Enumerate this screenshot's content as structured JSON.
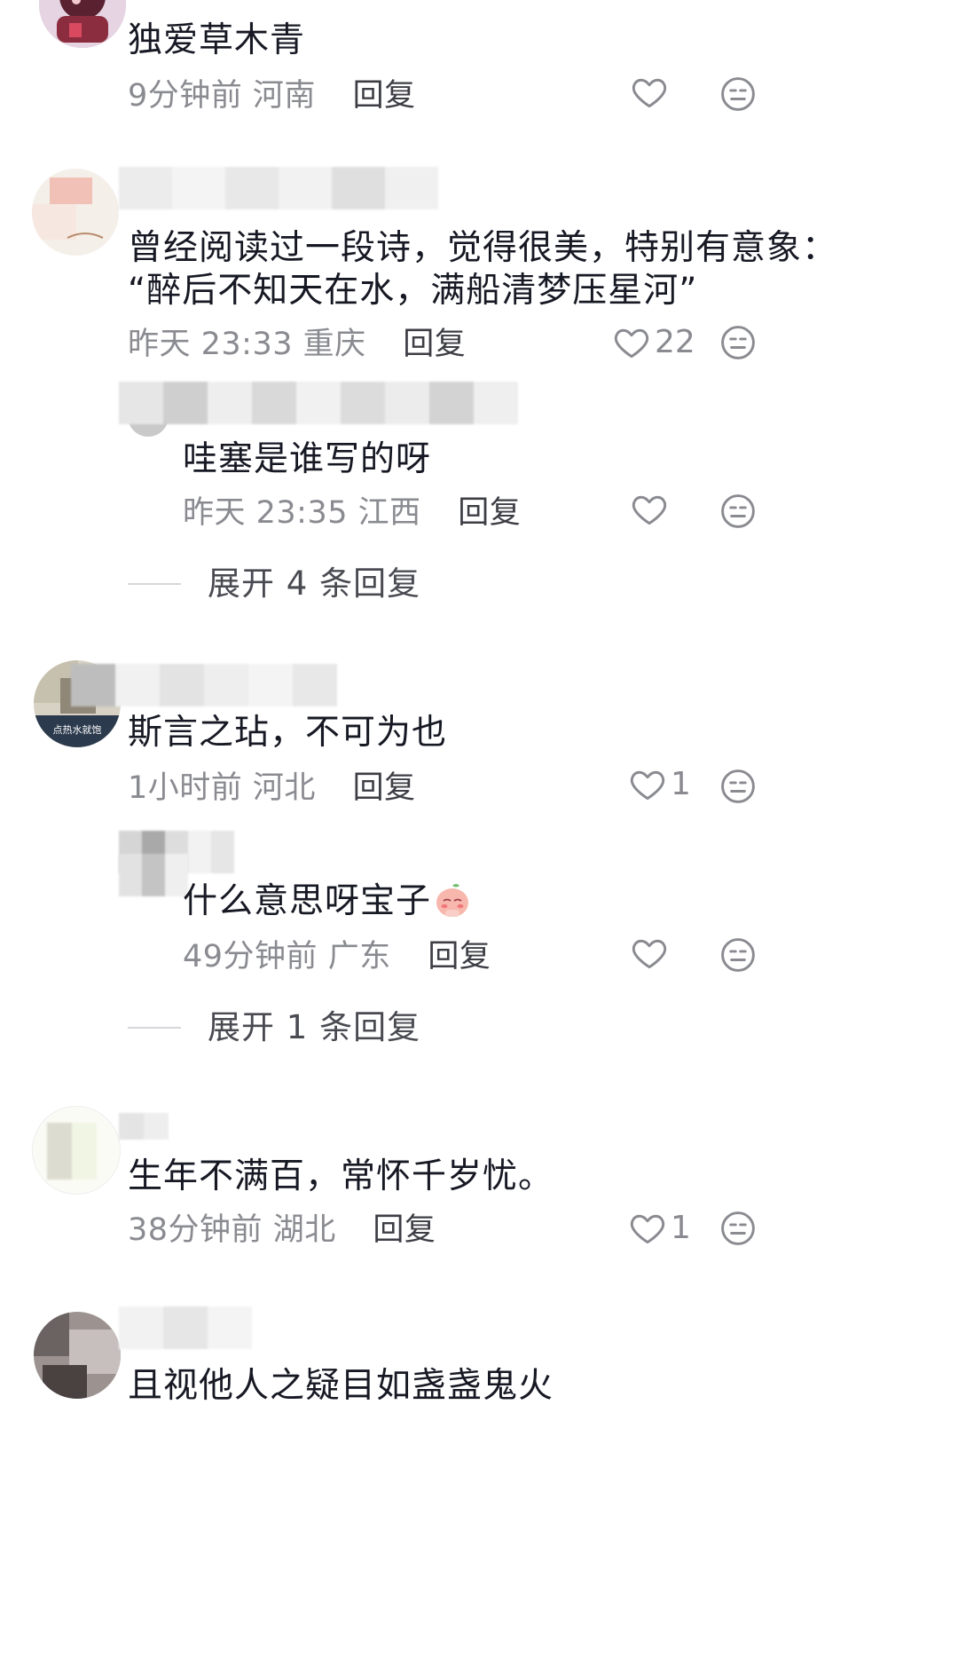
{
  "comments": [
    {
      "text": "独爱草木青",
      "time": "9分钟前",
      "region": "河南",
      "reply": "回复",
      "likes": ""
    },
    {
      "text_line1": "曾经阅读过一段诗，觉得很美，特别有意象：",
      "text_line2": "“醉后不知天在水，满船清梦压星河”",
      "time": "昨天 23:33",
      "region": "重庆",
      "reply": "回复",
      "likes": "22",
      "sub_reply": {
        "text": "哇塞是谁写的呀",
        "time": "昨天 23:35",
        "region": "江西",
        "reply": "回复",
        "likes": ""
      },
      "expand": "展开 4 条回复"
    },
    {
      "text": "斯言之玷，不可为也",
      "avatar_caption": "点热水就饱",
      "time": "1小时前",
      "region": "河北",
      "reply": "回复",
      "likes": "1",
      "sub_reply": {
        "text": "什么意思呀宝子",
        "time": "49分钟前",
        "region": "广东",
        "reply": "回复",
        "likes": ""
      },
      "expand": "展开 1 条回复"
    },
    {
      "text": "生年不满百，常怀千岁忧。",
      "time": "38分钟前",
      "region": "湖北",
      "reply": "回复",
      "likes": "1"
    },
    {
      "text": "且视他人之疑目如盏盏鬼火"
    }
  ],
  "icons": {
    "like": "heart-outline-icon",
    "dislike": "meh-face-icon",
    "emoji": "shy-peach-emoji"
  },
  "colors": {
    "text": "#161823",
    "meta": "#8a8b91",
    "reply": "#3d3e45",
    "icon": "#8a8b91"
  }
}
